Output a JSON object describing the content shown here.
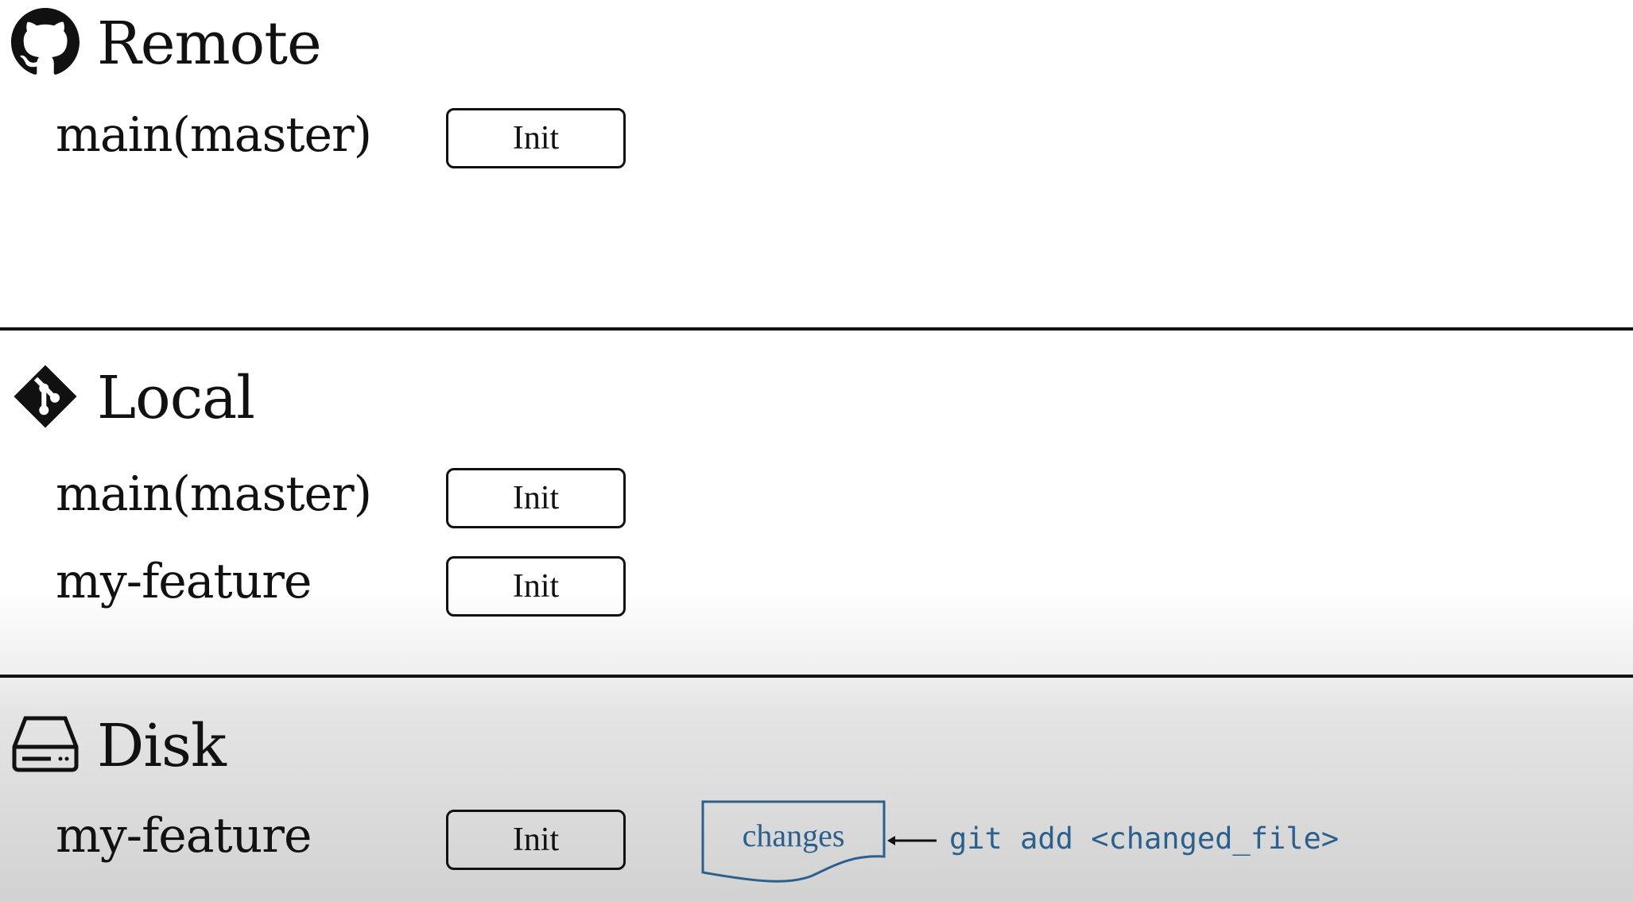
{
  "sections": {
    "remote": {
      "title": "Remote",
      "icon": "github-icon",
      "branches": [
        {
          "name": "main(master)",
          "commit": "Init"
        }
      ]
    },
    "local": {
      "title": "Local",
      "icon": "git-icon",
      "branches": [
        {
          "name": "main(master)",
          "commit": "Init"
        },
        {
          "name": "my-feature",
          "commit": "Init"
        }
      ]
    },
    "disk": {
      "title": "Disk",
      "icon": "hard-drive-icon",
      "branches": [
        {
          "name": "my-feature",
          "commit": "Init"
        }
      ],
      "changes_label": "changes",
      "command": "git add <changed_file>"
    }
  },
  "colors": {
    "accent": "#2b5f8e",
    "text": "#111111"
  }
}
